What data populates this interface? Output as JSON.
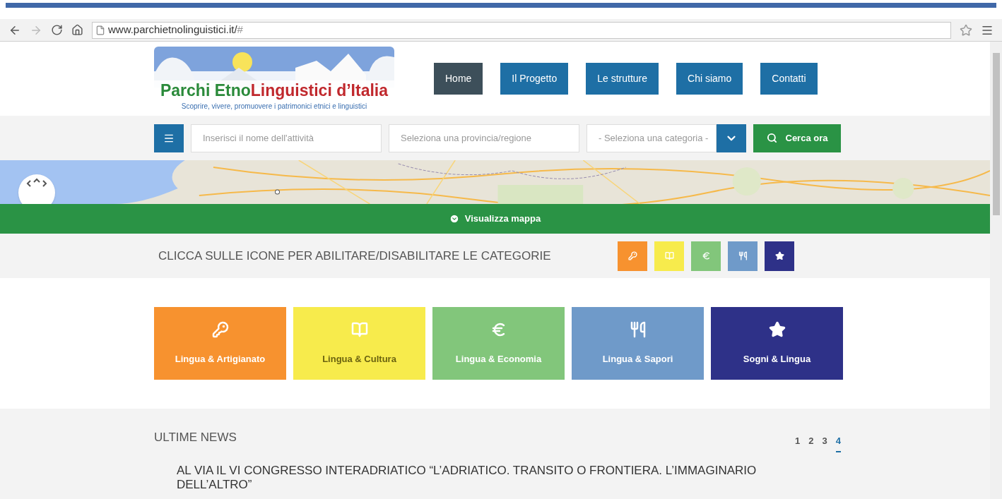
{
  "browser": {
    "url": "www.parchietnolinguistici.it/",
    "url_suffix": "#",
    "forward_disabled": true
  },
  "logo": {
    "title_green": "Parchi Etno",
    "title_red": "Linguistici d’Italia",
    "tagline": "Scoprire, vivere, promuovere i patrimonici etnici e linguistici"
  },
  "nav": [
    {
      "label": "Home",
      "selected": true
    },
    {
      "label": "Il Progetto",
      "selected": false
    },
    {
      "label": "Le strutture",
      "selected": false
    },
    {
      "label": "Chi siamo",
      "selected": false
    },
    {
      "label": "Contatti",
      "selected": false
    }
  ],
  "search": {
    "name_placeholder": "Inserisci il nome dell'attività",
    "place_placeholder": "Seleziona una provincia/regione",
    "category_value": "- Seleziona una categoria -",
    "button": "Cerca ora"
  },
  "map": {
    "kind": "picture",
    "toggle": "Visualizza mappa"
  },
  "categories_hint": "CLICCA SULLE ICONE PER ABILITARE/DISABILITARE LE CATEGORIE",
  "categories": [
    {
      "kind": "key",
      "label": "Lingua & Artigianato",
      "color": "#f7922f"
    },
    {
      "kind": "book",
      "label": "Lingua & Cultura",
      "color": "#f7eb4c"
    },
    {
      "kind": "euro",
      "label": "Lingua & Economia",
      "color": "#82c67b"
    },
    {
      "kind": "food",
      "label": "Lingua & Sapori",
      "color": "#6f9ac9"
    },
    {
      "kind": "star",
      "label": "Sogni & Lingua",
      "color": "#2e3188"
    }
  ],
  "news": {
    "title": "ULTIME NEWS",
    "pages": [
      {
        "label": "1",
        "selected": false
      },
      {
        "label": "2",
        "selected": false
      },
      {
        "label": "3",
        "selected": false
      },
      {
        "label": "4",
        "selected": true
      }
    ],
    "headline": "AL VIA IL VI CONGRESSO INTERADRIATICO “L’ADRIATICO. TRANSITO O FRONTIERA. L’IMMAGINARIO DELL’ALTRO”"
  }
}
